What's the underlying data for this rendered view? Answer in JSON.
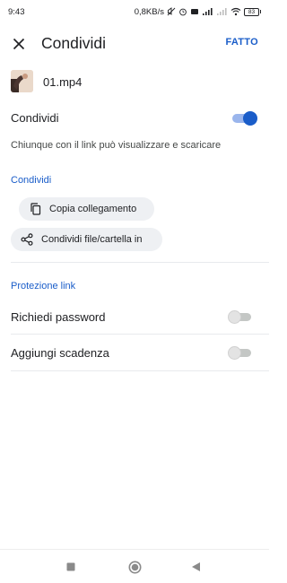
{
  "status_bar": {
    "time": "9:43",
    "net_speed": "0,8KB/s",
    "battery": "83"
  },
  "header": {
    "title": "Condividi",
    "done_label": "FATTO"
  },
  "file": {
    "name": "01.mp4"
  },
  "share": {
    "label": "Condividi",
    "enabled": true,
    "description": "Chiunque con il link può visualizzare e scaricare"
  },
  "share_section": {
    "title": "Condividi",
    "copy_link_label": "Copia collegamento",
    "share_file_label": "Condividi file/cartella in"
  },
  "link_protection": {
    "title": "Protezione link",
    "require_password_label": "Richiedi password",
    "require_password_enabled": false,
    "add_expiry_label": "Aggiungi scadenza",
    "add_expiry_enabled": false
  },
  "colors": {
    "accent": "#1a5dc9",
    "toggle_track_on": "#9ab5ec",
    "chip_bg": "#eef0f3"
  },
  "icons": {
    "close": "close-icon",
    "copy": "copy-icon",
    "share": "share-icon",
    "nav_recent": "square-icon",
    "nav_home": "circle-icon",
    "nav_back": "triangle-back-icon"
  }
}
